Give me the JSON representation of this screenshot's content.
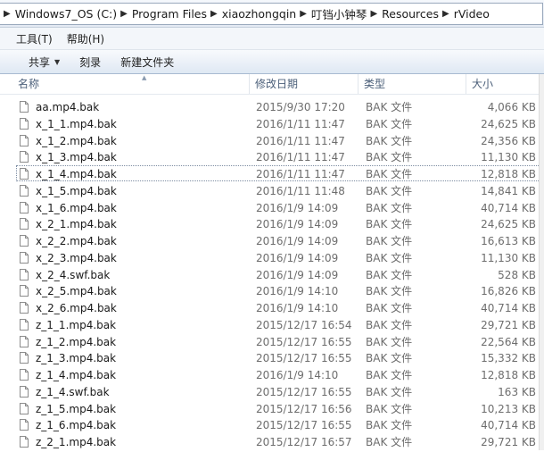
{
  "breadcrumb": [
    "Windows7_OS (C:)",
    "Program Files",
    "xiaozhongqin",
    "叮铛小钟琴",
    "Resources",
    "rVideo"
  ],
  "menu": [
    "工具(T)",
    "帮助(H)"
  ],
  "toolbar": {
    "share_label": "共享",
    "burn_label": "刻录",
    "new_folder_label": "新建文件夹"
  },
  "columns": {
    "name": "名称",
    "date": "修改日期",
    "type": "类型",
    "size": "大小"
  },
  "files": [
    {
      "name": "aa.mp4.bak",
      "date": "2015/9/30 17:20",
      "type": "BAK 文件",
      "size": "4,066 KB"
    },
    {
      "name": "x_1_1.mp4.bak",
      "date": "2016/1/11 11:47",
      "type": "BAK 文件",
      "size": "24,625 KB"
    },
    {
      "name": "x_1_2.mp4.bak",
      "date": "2016/1/11 11:47",
      "type": "BAK 文件",
      "size": "24,356 KB"
    },
    {
      "name": "x_1_3.mp4.bak",
      "date": "2016/1/11 11:47",
      "type": "BAK 文件",
      "size": "11,130 KB"
    },
    {
      "name": "x_1_4.mp4.bak",
      "date": "2016/1/11 11:47",
      "type": "BAK 文件",
      "size": "12,818 KB"
    },
    {
      "name": "x_1_5.mp4.bak",
      "date": "2016/1/11 11:48",
      "type": "BAK 文件",
      "size": "14,841 KB"
    },
    {
      "name": "x_1_6.mp4.bak",
      "date": "2016/1/9 14:09",
      "type": "BAK 文件",
      "size": "40,714 KB"
    },
    {
      "name": "x_2_1.mp4.bak",
      "date": "2016/1/9 14:09",
      "type": "BAK 文件",
      "size": "24,625 KB"
    },
    {
      "name": "x_2_2.mp4.bak",
      "date": "2016/1/9 14:09",
      "type": "BAK 文件",
      "size": "16,613 KB"
    },
    {
      "name": "x_2_3.mp4.bak",
      "date": "2016/1/9 14:09",
      "type": "BAK 文件",
      "size": "11,130 KB"
    },
    {
      "name": "x_2_4.swf.bak",
      "date": "2016/1/9 14:09",
      "type": "BAK 文件",
      "size": "528 KB"
    },
    {
      "name": "x_2_5.mp4.bak",
      "date": "2016/1/9 14:10",
      "type": "BAK 文件",
      "size": "16,826 KB"
    },
    {
      "name": "x_2_6.mp4.bak",
      "date": "2016/1/9 14:10",
      "type": "BAK 文件",
      "size": "40,714 KB"
    },
    {
      "name": "z_1_1.mp4.bak",
      "date": "2015/12/17 16:54",
      "type": "BAK 文件",
      "size": "29,721 KB"
    },
    {
      "name": "z_1_2.mp4.bak",
      "date": "2015/12/17 16:55",
      "type": "BAK 文件",
      "size": "22,564 KB"
    },
    {
      "name": "z_1_3.mp4.bak",
      "date": "2015/12/17 16:55",
      "type": "BAK 文件",
      "size": "15,332 KB"
    },
    {
      "name": "z_1_4.mp4.bak",
      "date": "2016/1/9 14:10",
      "type": "BAK 文件",
      "size": "12,818 KB"
    },
    {
      "name": "z_1_4.swf.bak",
      "date": "2015/12/17 16:55",
      "type": "BAK 文件",
      "size": "163 KB"
    },
    {
      "name": "z_1_5.mp4.bak",
      "date": "2015/12/17 16:56",
      "type": "BAK 文件",
      "size": "10,213 KB"
    },
    {
      "name": "z_1_6.mp4.bak",
      "date": "2015/12/17 16:55",
      "type": "BAK 文件",
      "size": "40,714 KB"
    },
    {
      "name": "z_2_1.mp4.bak",
      "date": "2015/12/17 16:57",
      "type": "BAK 文件",
      "size": "29,721 KB"
    }
  ],
  "selected_file": "x_1_4.mp4.bak",
  "icons": {
    "breadcrumb_separator": "chevron-right-icon",
    "share_dropdown": "caret-down-icon",
    "file": "document-icon",
    "sort": "sort-ascending-icon"
  }
}
